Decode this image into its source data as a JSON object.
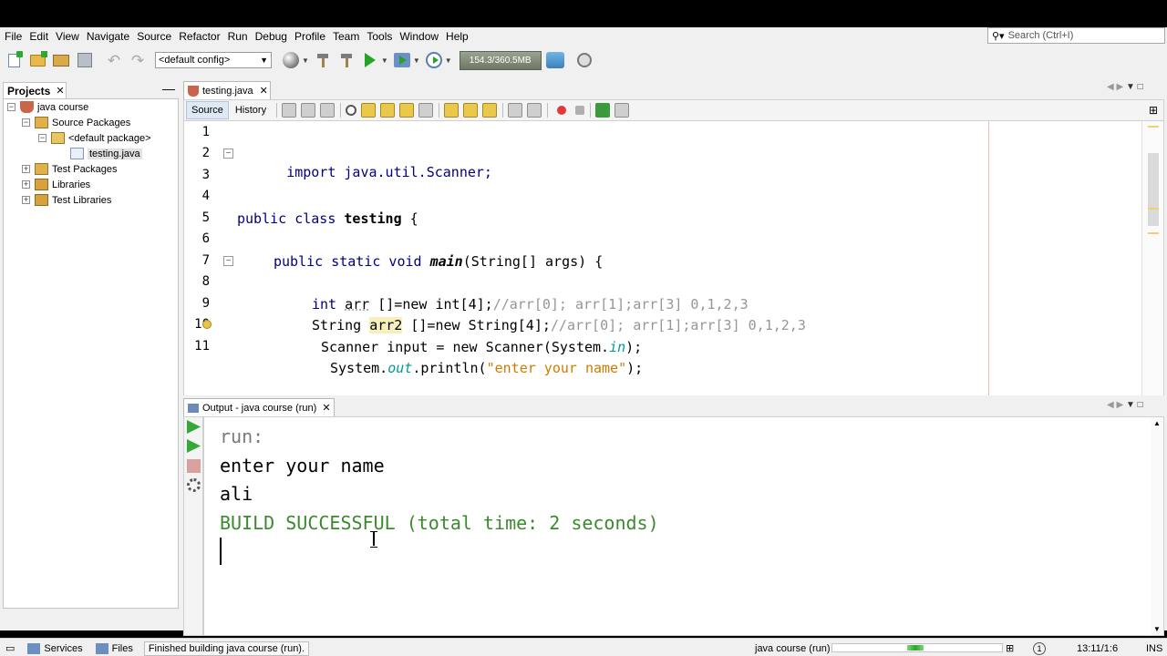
{
  "menu": [
    "File",
    "Edit",
    "View",
    "Navigate",
    "Source",
    "Refactor",
    "Run",
    "Debug",
    "Profile",
    "Team",
    "Tools",
    "Window",
    "Help"
  ],
  "search": {
    "placeholder": "Search (Ctrl+I)"
  },
  "toolbar": {
    "config": "<default config>",
    "memory": "154.3/360.5MB"
  },
  "projects": {
    "tab_label": "Projects",
    "tree": {
      "project": "java course",
      "source_packages": "Source Packages",
      "default_package": "<default package>",
      "file": "testing.java",
      "test_packages": "Test Packages",
      "libraries": "Libraries",
      "test_libraries": "Test Libraries"
    }
  },
  "editor": {
    "tab_label": "testing.java",
    "source_tab": "Source",
    "history_tab": "History",
    "line_numbers": [
      "1",
      "2",
      "3",
      "4",
      "5",
      "6",
      "7",
      "8",
      "9",
      "10",
      "11"
    ],
    "lines": {
      "l2": "import java.util.Scanner;",
      "l5_a": "public class ",
      "l5_b": "testing",
      "l5_c": " {",
      "l7_a": "public static void ",
      "l7_b": "main",
      "l7_c": "(String[] args) {",
      "l9_a": "int ",
      "l9_b": "arr",
      "l9_c": " []=new int[4];",
      "l9_d": "//arr[0]; arr[1];arr[3] 0,1,2,3",
      "l10_a": "String ",
      "l10_b": "arr2",
      "l10_c": " []=new String[4];",
      "l10_d": "//arr[0]; arr[1];arr[3] 0,1,2,3",
      "l11_a": "Scanner input = new Scanner(System.",
      "l11_b": "in",
      "l11_c": ");",
      "l12_a": "System.",
      "l12_b": "out",
      "l12_c": ".println(",
      "l12_d": "\"enter your name\"",
      "l12_e": ");"
    }
  },
  "output": {
    "tab_label": "Output - java course (run)",
    "lines": {
      "run": "run:",
      "prompt": "enter your name",
      "input": "ali",
      "result": "BUILD SUCCESSFUL (total time: 2 seconds)"
    }
  },
  "status": {
    "services": "Services",
    "files": "Files",
    "message": "Finished building java course (run).",
    "task": "java course (run)",
    "progress_fraction": 0.5,
    "position": "13:11/1:6",
    "mode": "INS"
  },
  "colors": {
    "keyword": "#000080",
    "comment": "#969696",
    "success": "#3b8a2e",
    "highlight": "#f7f0bb"
  }
}
